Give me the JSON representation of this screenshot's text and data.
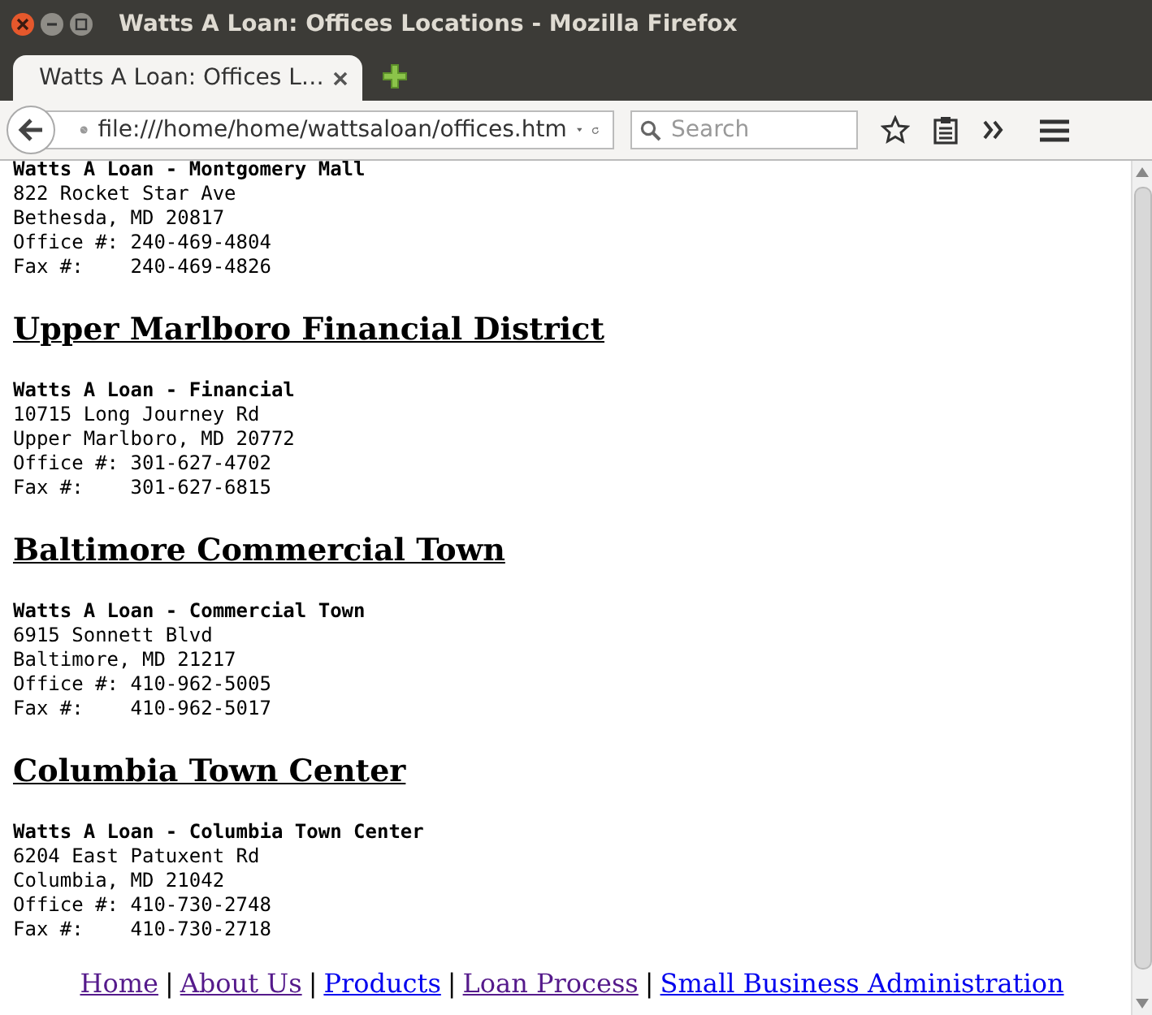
{
  "window": {
    "title": "Watts A Loan: Offices Locations - Mozilla Firefox"
  },
  "tabs": [
    {
      "label": "Watts A Loan: Offices L…",
      "selected": true
    }
  ],
  "address_bar": {
    "value": "file:///home/home/wattsaloan/offices.htm"
  },
  "search": {
    "placeholder": "Search"
  },
  "offices": [
    {
      "name": "Watts A Loan - Montgomery Mall",
      "lines": [
        "822 Rocket Star Ave",
        "Bethesda, MD 20817",
        "Office #: 240-469-4804",
        "Fax #:    240-469-4826"
      ]
    },
    {
      "heading": "Upper Marlboro Financial District",
      "name": "Watts A Loan - Financial",
      "lines": [
        "10715 Long Journey Rd",
        "Upper Marlboro, MD 20772",
        "Office #: 301-627-4702",
        "Fax #:    301-627-6815"
      ]
    },
    {
      "heading": "Baltimore Commercial Town",
      "name": "Watts A Loan - Commercial Town",
      "lines": [
        "6915 Sonnett Blvd",
        "Baltimore, MD 21217",
        "Office #: 410-962-5005",
        "Fax #:    410-962-5017"
      ]
    },
    {
      "heading": "Columbia Town Center",
      "name": "Watts A Loan - Columbia Town Center",
      "lines": [
        "6204 East Patuxent Rd",
        "Columbia, MD 21042",
        "Office #: 410-730-2748",
        "Fax #:    410-730-2718"
      ]
    }
  ],
  "footer": {
    "separator": "|",
    "links": [
      {
        "label": "Home",
        "visited": true
      },
      {
        "label": "About Us",
        "visited": true
      },
      {
        "label": "Products",
        "visited": false
      },
      {
        "label": "Loan Process",
        "visited": true
      },
      {
        "label": "Small Business Administration",
        "visited": false
      }
    ]
  }
}
